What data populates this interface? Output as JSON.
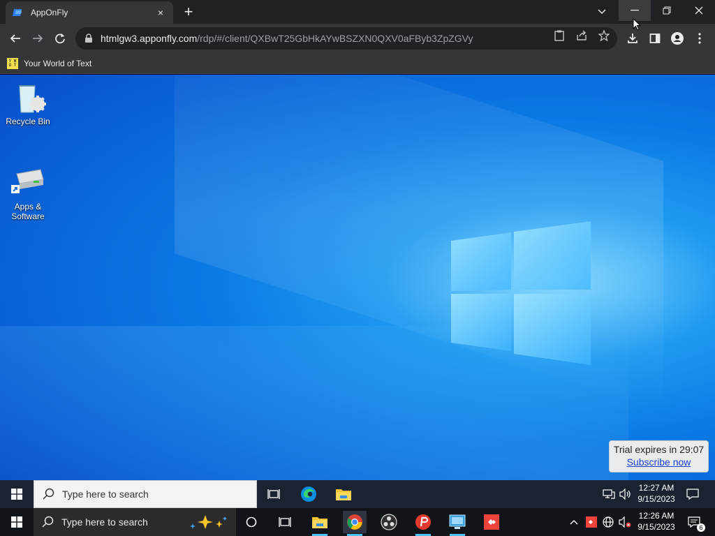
{
  "browser": {
    "tab_title": "AppOnFly",
    "tab_close": "×",
    "new_tab": "+",
    "url_host": "htmlgw3.apponfly.com",
    "url_path": "/rdp/#/client/QXBwT25GbHkAYwBSZXN0QXV0aFByb3ZpZGVy",
    "bookmark_label": "Your World of Text",
    "bookmark_icon_text": "Y W O T"
  },
  "desktop": {
    "icons": [
      {
        "label": "Recycle Bin",
        "icon": "recycle-bin-icon"
      },
      {
        "label": "Apps & Software",
        "icon": "apps-software-icon"
      }
    ],
    "trial": {
      "text": "Trial expires in 29:07",
      "link": "Subscribe now"
    }
  },
  "remote_taskbar": {
    "search_placeholder": "Type here to search",
    "time": "12:27 AM",
    "date": "9/15/2023"
  },
  "local_taskbar": {
    "search_placeholder": "Type here to search",
    "time": "12:26 AM",
    "date": "9/15/2023",
    "notification_count": "6"
  },
  "colors": {
    "accent_blue": "#0a79e4",
    "chrome_dark": "#202124",
    "chrome_toolbar": "#35363a"
  }
}
